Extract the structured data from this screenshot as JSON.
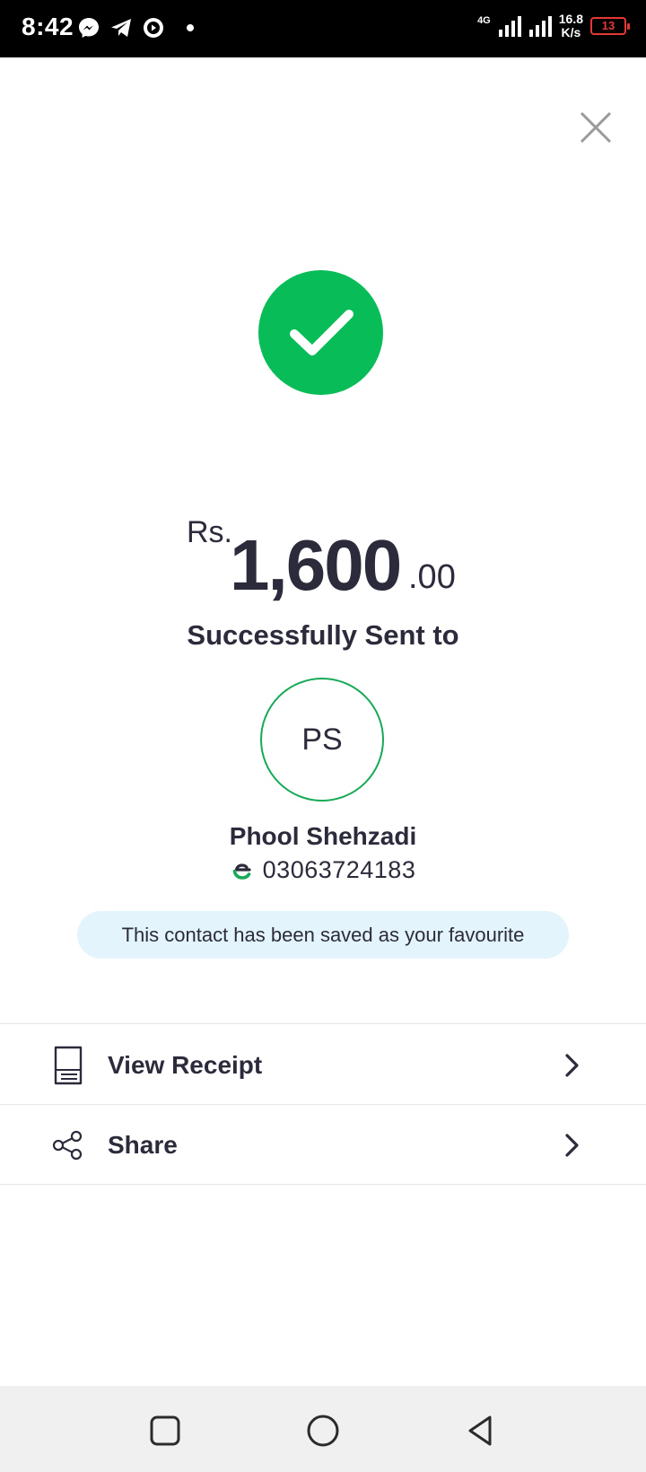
{
  "status_bar": {
    "time": "8:42",
    "network_type": "4G",
    "speed_value": "16.8",
    "speed_unit": "K/s",
    "battery": "13",
    "icons": [
      "messenger-icon",
      "telegram-icon",
      "media-icon",
      "notification-dot"
    ]
  },
  "transaction": {
    "currency": "Rs.",
    "amount": "1,600",
    "decimal": ".00",
    "status_text": "Successfully Sent to"
  },
  "recipient": {
    "initials": "PS",
    "name": "Phool Shehzadi",
    "phone": "03063724183"
  },
  "favourite_message": "This contact has been saved as your favourite",
  "actions": [
    {
      "label": "View Receipt",
      "icon": "receipt-icon"
    },
    {
      "label": "Share",
      "icon": "share-icon"
    }
  ],
  "colors": {
    "success": "#08bc57",
    "avatar_border": "#18a957",
    "banner_bg": "#e3f4fd",
    "text": "#2b2b3c",
    "battery_low": "#e53935"
  },
  "nav": [
    "recents-button",
    "home-button",
    "back-button"
  ]
}
